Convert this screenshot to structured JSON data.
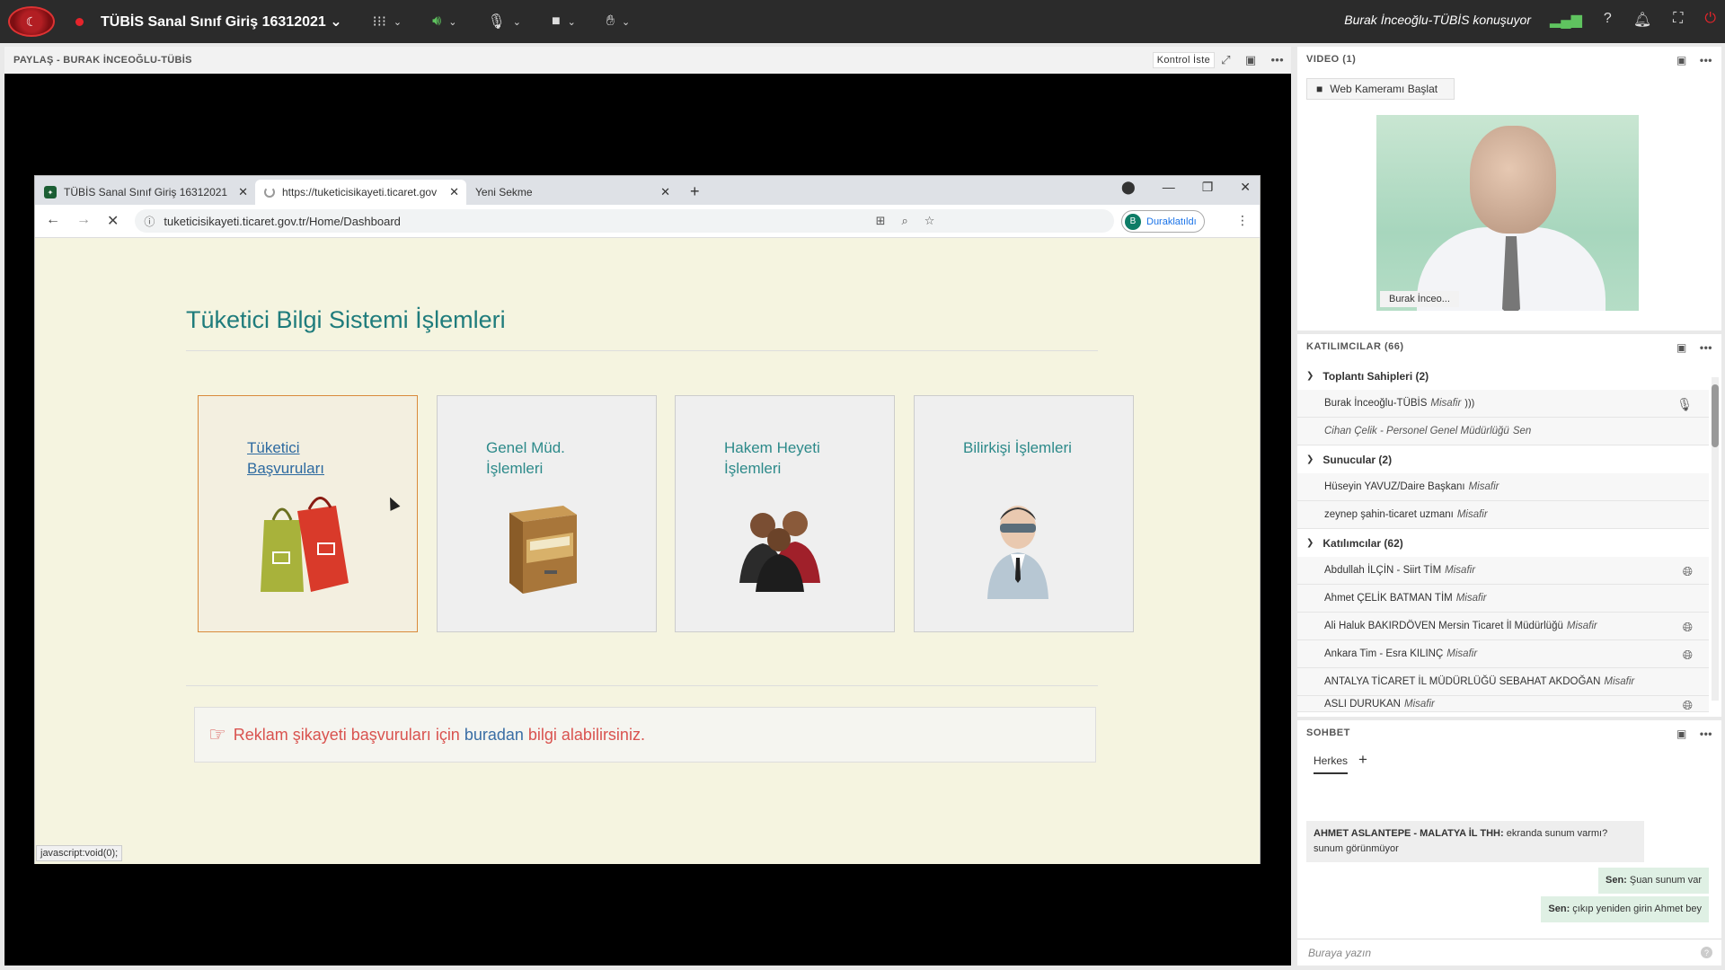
{
  "topbar": {
    "meeting_title": "TÜBİS Sanal Sınıf Giriş 16312021",
    "speaking": "Burak İnceoğlu-TÜBİS konuşuyor"
  },
  "share": {
    "header": "PAYLAŞ  - BURAK İNCEOĞLU-TÜBİS",
    "control_button": "Kontrol İste"
  },
  "browser": {
    "tabs": [
      {
        "label": "TÜBİS Sanal Sınıf Giriş 16312021"
      },
      {
        "label": "https://tuketicisikayeti.ticaret.gov"
      },
      {
        "label": "Yeni Sekme"
      }
    ],
    "url": "tuketicisikayeti.ticaret.gov.tr/Home/Dashboard",
    "profile_initial": "B",
    "paused_label": "Duraklatıldı",
    "status_text": "javascript:void(0);"
  },
  "page": {
    "title": "Tüketici Bilgi Sistemi İşlemleri",
    "cards": [
      {
        "line1": "Tüketici",
        "line2": "Başvuruları"
      },
      {
        "line1": "Genel Müd.",
        "line2": "İşlemleri"
      },
      {
        "line1": "Hakem Heyeti",
        "line2": "İşlemleri"
      },
      {
        "line1": "Bilirkişi İşlemleri",
        "line2": ""
      }
    ],
    "notice": {
      "before": "Reklam şikayeti başvuruları için",
      "link": "buradan",
      "after": "bilgi alabilirsiniz."
    }
  },
  "video": {
    "header": "VIDEO (1)",
    "cam_button": "Web Kameramı Başlat",
    "name_tag": "Burak İnceo..."
  },
  "participants": {
    "header": "KATILIMCILAR  (66)",
    "groups": [
      {
        "title": "Toplantı Sahipleri (2)",
        "rows": [
          {
            "name": "Burak İnceoğlu-TÜBİS",
            "role": "Misafir"
          },
          {
            "name": "Cihan Çelik - Personel Genel Müdürlüğü",
            "role": "Sen"
          }
        ]
      },
      {
        "title": "Sunucular (2)",
        "rows": [
          {
            "name": "Hüseyin YAVUZ/Daire Başkanı",
            "role": "Misafir"
          },
          {
            "name": "zeynep şahin-ticaret uzmanı",
            "role": "Misafir"
          }
        ]
      },
      {
        "title": "Katılımcılar (62)",
        "rows": [
          {
            "name": "Abdullah İLÇİN - Siirt TİM",
            "role": "Misafir"
          },
          {
            "name": "Ahmet ÇELİK BATMAN TİM",
            "role": "Misafir"
          },
          {
            "name": "Ali Haluk BAKIRDÖVEN Mersin Ticaret İl Müdürlüğü",
            "role": "Misafir"
          },
          {
            "name": "Ankara Tim - Esra KILINÇ",
            "role": "Misafir"
          },
          {
            "name": "ANTALYA TİCARET İL MÜDÜRLÜĞÜ SEBAHAT AKDOĞAN",
            "role": "Misafir"
          },
          {
            "name": "ASLI DURUKAN",
            "role": "Misafir"
          }
        ]
      }
    ]
  },
  "chat": {
    "header": "SOHBET",
    "tab": "Herkes",
    "messages": [
      {
        "sender": "AHMET ASLANTEPE - MALATYA İL THH:",
        "text": "ekranda sunum varmı? sunum görünmüyor"
      },
      {
        "sender": "Sen:",
        "text": "Şuan sunum var"
      },
      {
        "sender": "Sen:",
        "text": "çıkıp yeniden girin Ahmet bey"
      }
    ],
    "input_placeholder": "Buraya yazın"
  }
}
